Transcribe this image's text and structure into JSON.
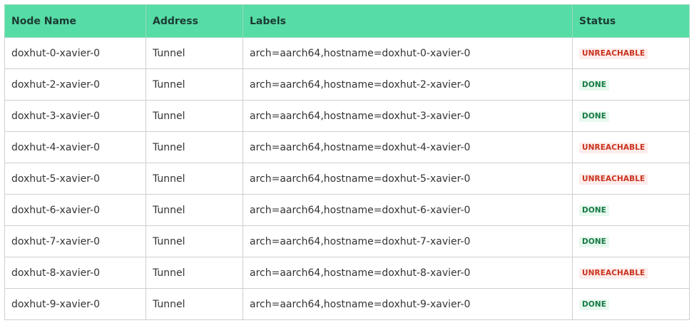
{
  "table": {
    "headers": {
      "node_name": "Node Name",
      "address": "Address",
      "labels": "Labels",
      "status": "Status"
    },
    "rows": [
      {
        "node_name": "doxhut-0-xavier-0",
        "address": "Tunnel",
        "labels": "arch=aarch64,hostname=doxhut-0-xavier-0",
        "status": "UNREACHABLE",
        "status_kind": "unreachable"
      },
      {
        "node_name": "doxhut-2-xavier-0",
        "address": "Tunnel",
        "labels": "arch=aarch64,hostname=doxhut-2-xavier-0",
        "status": "DONE",
        "status_kind": "done"
      },
      {
        "node_name": "doxhut-3-xavier-0",
        "address": "Tunnel",
        "labels": "arch=aarch64,hostname=doxhut-3-xavier-0",
        "status": "DONE",
        "status_kind": "done"
      },
      {
        "node_name": "doxhut-4-xavier-0",
        "address": "Tunnel",
        "labels": "arch=aarch64,hostname=doxhut-4-xavier-0",
        "status": "UNREACHABLE",
        "status_kind": "unreachable"
      },
      {
        "node_name": "doxhut-5-xavier-0",
        "address": "Tunnel",
        "labels": "arch=aarch64,hostname=doxhut-5-xavier-0",
        "status": "UNREACHABLE",
        "status_kind": "unreachable"
      },
      {
        "node_name": "doxhut-6-xavier-0",
        "address": "Tunnel",
        "labels": "arch=aarch64,hostname=doxhut-6-xavier-0",
        "status": "DONE",
        "status_kind": "done"
      },
      {
        "node_name": "doxhut-7-xavier-0",
        "address": "Tunnel",
        "labels": "arch=aarch64,hostname=doxhut-7-xavier-0",
        "status": "DONE",
        "status_kind": "done"
      },
      {
        "node_name": "doxhut-8-xavier-0",
        "address": "Tunnel",
        "labels": "arch=aarch64,hostname=doxhut-8-xavier-0",
        "status": "UNREACHABLE",
        "status_kind": "unreachable"
      },
      {
        "node_name": "doxhut-9-xavier-0",
        "address": "Tunnel",
        "labels": "arch=aarch64,hostname=doxhut-9-xavier-0",
        "status": "DONE",
        "status_kind": "done"
      }
    ]
  },
  "colors": {
    "header_bg": "#56dca5",
    "unreachable_text": "#c9331f",
    "unreachable_bg": "#fdecea",
    "done_text": "#157a44",
    "done_bg": "#e7f8ee"
  }
}
